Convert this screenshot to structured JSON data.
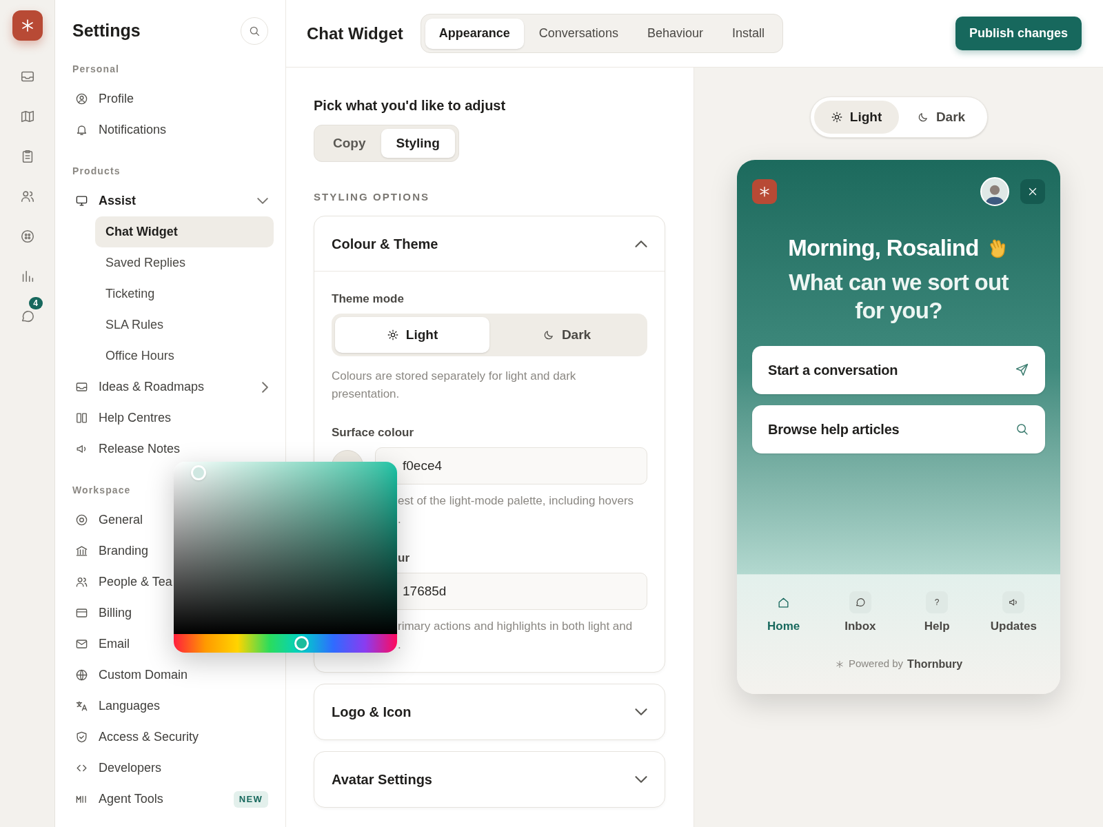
{
  "rail": {
    "badge": "4"
  },
  "sidebar": {
    "title": "Settings",
    "sections": [
      {
        "heading": "Personal",
        "items": [
          {
            "label": "Profile"
          },
          {
            "label": "Notifications"
          }
        ]
      },
      {
        "heading": "Products",
        "items": [
          {
            "label": "Assist",
            "expanded": true,
            "children": [
              {
                "label": "Chat Widget",
                "selected": true
              },
              {
                "label": "Saved Replies",
                "selected": false
              },
              {
                "label": "Ticketing",
                "selected": false
              },
              {
                "label": "SLA Rules",
                "selected": false
              },
              {
                "label": "Office Hours",
                "selected": false
              }
            ]
          },
          {
            "label": "Ideas & Roadmaps",
            "expanded": false
          },
          {
            "label": "Help Centres"
          },
          {
            "label": "Release Notes"
          }
        ]
      },
      {
        "heading": "Workspace",
        "items": [
          {
            "label": "General"
          },
          {
            "label": "Branding"
          },
          {
            "label": "People & Tea"
          },
          {
            "label": "Billing"
          },
          {
            "label": "Email"
          },
          {
            "label": "Custom Domain"
          },
          {
            "label": "Languages"
          },
          {
            "label": "Access & Security"
          },
          {
            "label": "Developers"
          },
          {
            "label": "Agent Tools",
            "badge": "NEW"
          }
        ]
      }
    ]
  },
  "header": {
    "title": "Chat Widget",
    "tabs": [
      {
        "label": "Appearance",
        "selected": true
      },
      {
        "label": "Conversations",
        "selected": false
      },
      {
        "label": "Behaviour",
        "selected": false
      },
      {
        "label": "Install",
        "selected": false
      }
    ],
    "publish": "Publish changes"
  },
  "editor": {
    "prompt": "Pick what you'd like to adjust",
    "modes": [
      {
        "label": "Copy",
        "selected": false
      },
      {
        "label": "Styling",
        "selected": true
      }
    ],
    "section_heading": "STYLING OPTIONS",
    "panels": [
      {
        "title": "Colour & Theme",
        "expanded": true
      },
      {
        "title": "Logo & Icon",
        "expanded": false
      },
      {
        "title": "Avatar Settings",
        "expanded": false
      }
    ],
    "theme_mode": {
      "label": "Theme mode",
      "options": [
        {
          "label": "Light",
          "selected": true,
          "kind": "sun"
        },
        {
          "label": "Dark",
          "selected": false,
          "kind": "moon"
        }
      ],
      "hint": "Colours are stored separately for light and dark presentation."
    },
    "fields": [
      {
        "label": "Surface colour",
        "value": "f0ece4",
        "hint": [
          "est of the light-mode palette, including hovers",
          "."
        ]
      },
      {
        "label": "ur",
        "value": "17685d",
        "hint": [
          "rimary actions and highlights in both light and",
          "."
        ]
      }
    ]
  },
  "picker": {
    "hue": {
      "level": 0.57
    }
  },
  "preview": {
    "appearance": [
      {
        "label": "Light",
        "selected": true,
        "kind": "sun"
      },
      {
        "label": "Dark",
        "selected": false,
        "kind": "moon"
      }
    ],
    "widget": {
      "greeting": "Morning, Rosalind",
      "question": "What can we sort out for you?",
      "actions": [
        {
          "label": "Start a conversation",
          "kind": "send"
        },
        {
          "label": "Browse help articles",
          "kind": "search"
        }
      ],
      "nav": [
        {
          "label": "Home",
          "selected": true,
          "kind": "home"
        },
        {
          "label": "Inbox",
          "selected": false,
          "kind": "chat"
        },
        {
          "label": "Help",
          "selected": false,
          "kind": "glyph",
          "glyph": "?"
        },
        {
          "label": "Updates",
          "selected": false,
          "kind": "speaker"
        }
      ],
      "powered_by": "Powered by",
      "brand": "Thornbury"
    }
  }
}
